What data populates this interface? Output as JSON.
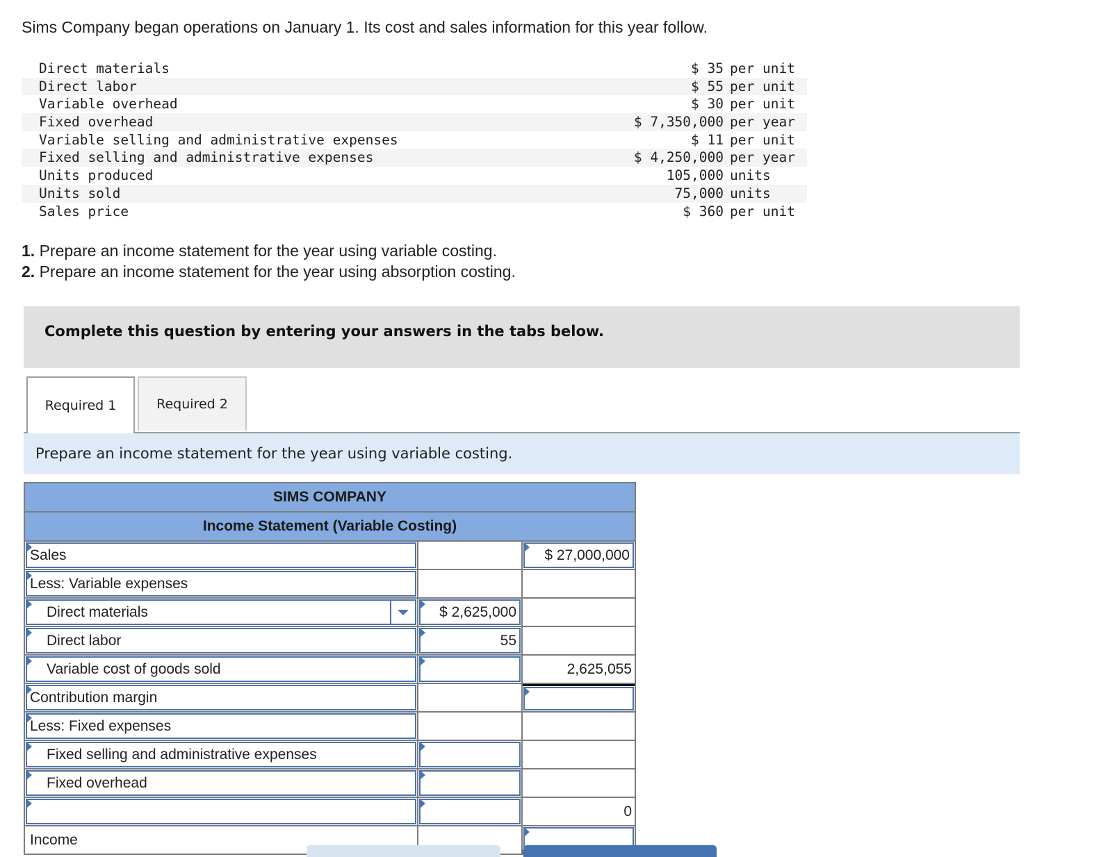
{
  "problem": {
    "intro": "Sims Company began operations on January 1. Its cost and sales information for this year follow.",
    "given": [
      {
        "label": "Direct materials",
        "amount": "$ 35",
        "unit": "per unit"
      },
      {
        "label": "Direct labor",
        "amount": "$ 55",
        "unit": "per unit"
      },
      {
        "label": "Variable overhead",
        "amount": "$ 30",
        "unit": "per unit"
      },
      {
        "label": "Fixed overhead",
        "amount": "$ 7,350,000",
        "unit": "per year"
      },
      {
        "label": "Variable selling and administrative expenses",
        "amount": "$ 11",
        "unit": "per unit"
      },
      {
        "label": "Fixed selling and administrative expenses",
        "amount": "$ 4,250,000",
        "unit": "per year"
      },
      {
        "label": "Units produced",
        "amount": "105,000",
        "unit": "units"
      },
      {
        "label": "Units sold",
        "amount": "75,000",
        "unit": "units"
      },
      {
        "label": "Sales price",
        "amount": "$ 360",
        "unit": "per unit"
      }
    ],
    "requirements": [
      {
        "num": "1.",
        "text": " Prepare an income statement for the year using variable costing."
      },
      {
        "num": "2.",
        "text": " Prepare an income statement for the year using absorption costing."
      }
    ]
  },
  "banner": "Complete this question by entering your answers in the tabs below.",
  "tabs": [
    {
      "label": "Required 1",
      "active": true
    },
    {
      "label": "Required 2",
      "active": false
    }
  ],
  "instruction": "Prepare an income statement for the year using variable costing.",
  "statement": {
    "company": "SIMS COMPANY",
    "title": "Income Statement (Variable Costing)",
    "rows": [
      {
        "label": "Sales",
        "col2": "",
        "col3": "$ 27,000,000"
      },
      {
        "label": "Less: Variable expenses",
        "col2": "",
        "col3": ""
      },
      {
        "label": "Direct materials",
        "col2": "$ 2,625,000",
        "col3": ""
      },
      {
        "label": "Direct labor",
        "col2": "55",
        "col3": ""
      },
      {
        "label": "Variable cost of goods sold",
        "col2": "",
        "col3": "2,625,055"
      },
      {
        "label": "Contribution margin",
        "col2": "",
        "col3": ""
      },
      {
        "label": "Less: Fixed expenses",
        "col2": "",
        "col3": ""
      },
      {
        "label": "Fixed selling and administrative expenses",
        "col2": "",
        "col3": ""
      },
      {
        "label": "Fixed overhead",
        "col2": "",
        "col3": ""
      },
      {
        "label": "",
        "col2": "",
        "col3": "0"
      },
      {
        "label": "Income",
        "col2": "",
        "col3": ""
      }
    ]
  },
  "colors": {
    "header_blue": "#84aadf",
    "input_border": "#4a73b0",
    "instruction_bg": "#deeaf7"
  }
}
